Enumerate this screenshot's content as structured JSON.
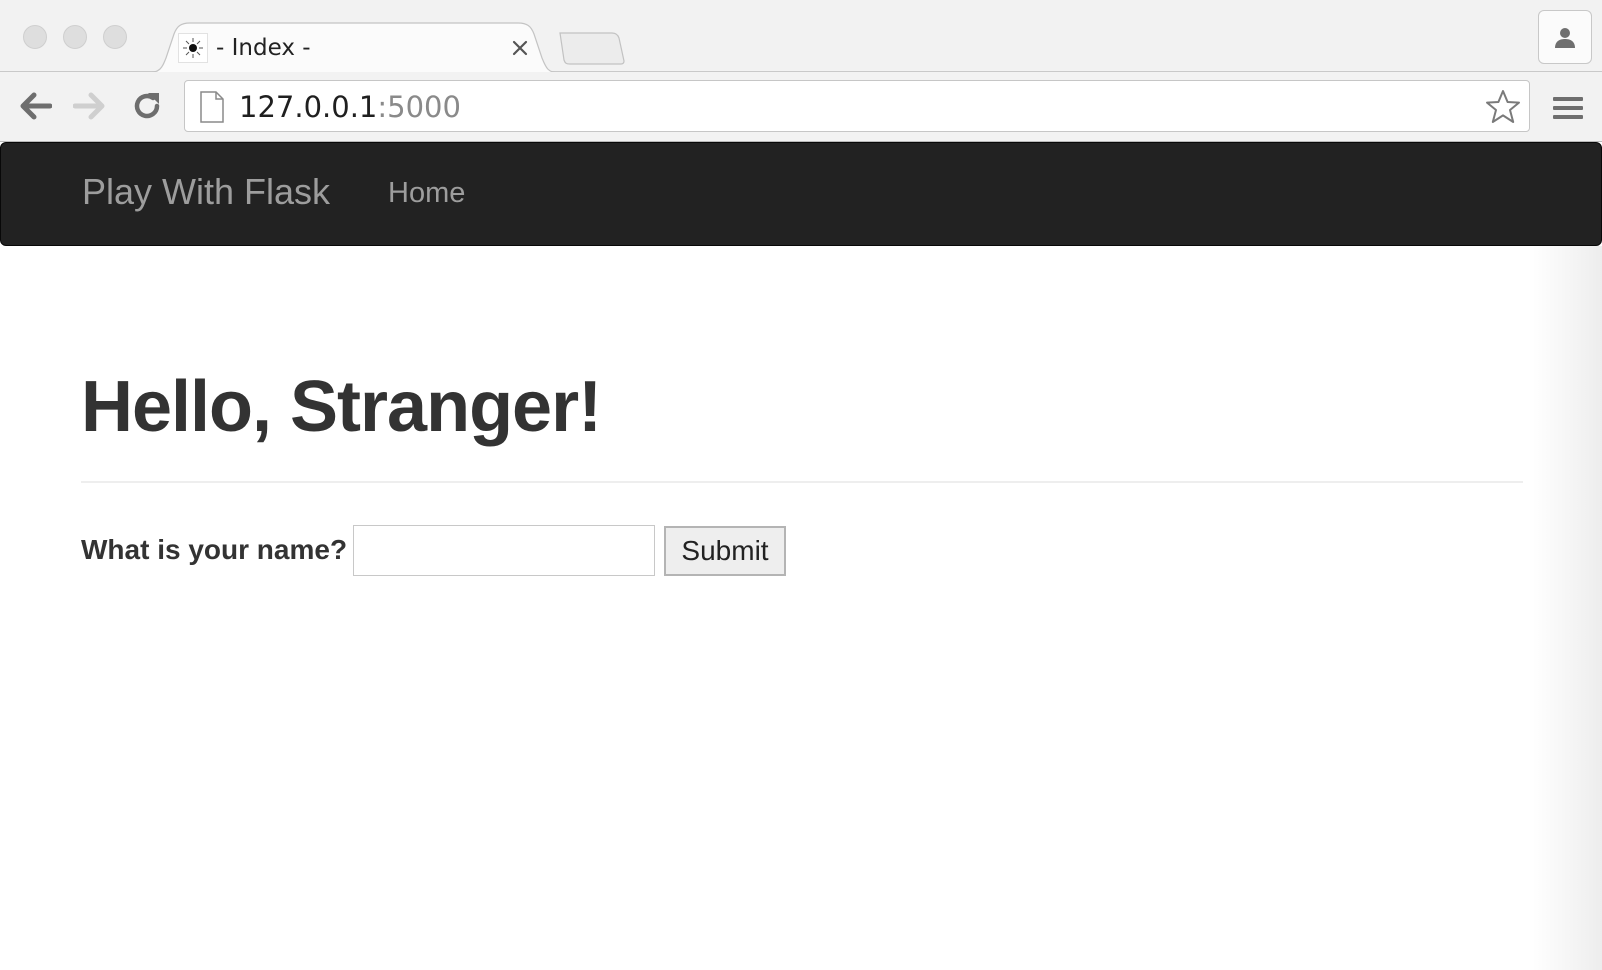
{
  "browser": {
    "tab": {
      "title": "- Index -"
    },
    "address_bar": {
      "host": "127.0.0.1",
      "port": ":5000"
    },
    "icons": {
      "back": "arrow-left-icon",
      "forward": "arrow-right-icon",
      "reload": "reload-icon",
      "bookmark": "star-icon",
      "menu": "hamburger-menu-icon",
      "profile": "person-icon",
      "page": "document-icon",
      "favicon": "flask-favicon-icon"
    }
  },
  "navbar": {
    "brand": "Play With Flask",
    "links": [
      {
        "label": "Home"
      }
    ]
  },
  "main": {
    "heading": "Hello, Stranger!",
    "form": {
      "label": "What is your name?",
      "input_value": "",
      "submit_label": "Submit"
    }
  },
  "colors": {
    "navbar_bg": "#222222",
    "navbar_text": "#9d9d9d",
    "heading_text": "#333333",
    "chrome_bg": "#f2f2f2"
  }
}
